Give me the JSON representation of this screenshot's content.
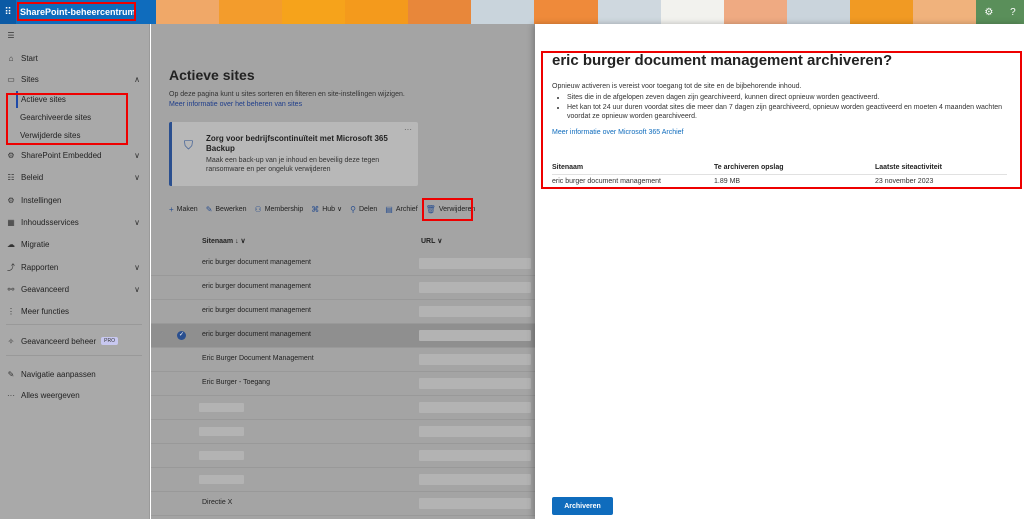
{
  "topbar": {
    "app_name": "SharePoint-beheercentrum",
    "banner_colors": [
      "#f0a868",
      "#f39c2c",
      "#f6a31b",
      "#f49a1c",
      "#e8873a",
      "#c9d4dc",
      "#ef8a3a",
      "#cfd8df",
      "#f2f2ee",
      "#efaa82",
      "#cad4dc",
      "#f19a23",
      "#f0b27c"
    ],
    "settings_icon": "gear-icon",
    "help_icon": "question-icon"
  },
  "nav": {
    "collapse_icon": "hamburger-icon",
    "items": [
      {
        "label": "Start",
        "icon": "home-icon"
      },
      {
        "label": "Sites",
        "icon": "sites-icon"
      },
      {
        "label": "SharePoint Embedded",
        "icon": "embedded-icon"
      },
      {
        "label": "Beleid",
        "icon": "policy-icon"
      },
      {
        "label": "Instellingen",
        "icon": "settings-icon"
      },
      {
        "label": "Inhoudsservices",
        "icon": "content-services-icon"
      },
      {
        "label": "Migratie",
        "icon": "migration-icon"
      },
      {
        "label": "Rapporten",
        "icon": "reports-icon"
      },
      {
        "label": "Geavanceerd",
        "icon": "advanced-icon"
      },
      {
        "label": "Meer functies",
        "icon": "more-features-icon"
      },
      {
        "label": "Geavanceerd beheer",
        "icon": "advanced-management-icon",
        "badge": "PRO"
      },
      {
        "label": "Navigatie aanpassen",
        "icon": "pencil-icon"
      },
      {
        "label": "Alles weergeven",
        "icon": "ellipsis-icon"
      }
    ],
    "sites_sub": [
      "Actieve sites",
      "Gearchiveerde sites",
      "Verwijderde sites"
    ]
  },
  "main": {
    "title": "Actieve sites",
    "description": "Op deze pagina kunt u sites sorteren en filteren en site-instellingen wijzigen.",
    "link": "Meer informatie over het beheren van sites",
    "card": {
      "title": "Zorg voor bedrijfscontinuïteit met Microsoft 365 Backup",
      "body": "Maak een back-up van je inhoud en beveilig deze tegen ransomware en per ongeluk verwijderen",
      "more": "···"
    },
    "toolbar": [
      {
        "label": "Maken",
        "icon": "+"
      },
      {
        "label": "Bewerken",
        "icon": "✎"
      },
      {
        "label": "Membership",
        "icon": "⚇"
      },
      {
        "label": "Hub",
        "icon": "⌘",
        "dropdown": "∨"
      },
      {
        "label": "Delen",
        "icon": "⚲"
      },
      {
        "label": "Archief",
        "icon": "▤"
      },
      {
        "label": "Verwijderen",
        "icon": "🗑"
      }
    ],
    "columns": {
      "name": "Sitenaam ↓ ∨",
      "url": "URL ∨"
    },
    "rows": [
      {
        "name": "eric burger document management",
        "selected": false
      },
      {
        "name": "eric burger document management",
        "selected": false
      },
      {
        "name": "eric burger document management",
        "selected": false
      },
      {
        "name": "eric burger document management",
        "selected": true
      },
      {
        "name": "Eric Burger Document Management",
        "selected": false
      },
      {
        "name": "Eric Burger - Toegang",
        "selected": false
      },
      {
        "name": "",
        "selected": false
      },
      {
        "name": "",
        "selected": false
      },
      {
        "name": "",
        "selected": false
      },
      {
        "name": "",
        "selected": false
      },
      {
        "name": "Directie X",
        "selected": false
      }
    ]
  },
  "panel": {
    "title": "eric burger document management archiveren?",
    "intro": "Opnieuw activeren is vereist voor toegang tot de site en de bijbehorende inhoud.",
    "bullet1": "Sites die in de afgelopen zeven dagen zijn gearchiveerd, kunnen direct opnieuw worden geactiveerd.",
    "bullet2": "Het kan tot 24 uur duren voordat sites die meer dan 7 dagen zijn gearchiveerd, opnieuw worden geactiveerd en moeten 4 maanden wachten voordat ze opnieuw worden gearchiveerd.",
    "link": "Meer informatie over Microsoft 365 Archief",
    "col_name": "Sitenaam",
    "col_storage": "Te archiveren opslag",
    "col_activity": "Laatste siteactiviteit",
    "val_name": "eric burger document management",
    "val_storage": "1.89 MB",
    "val_activity": "23 november 2023",
    "button": "Archiveren"
  }
}
